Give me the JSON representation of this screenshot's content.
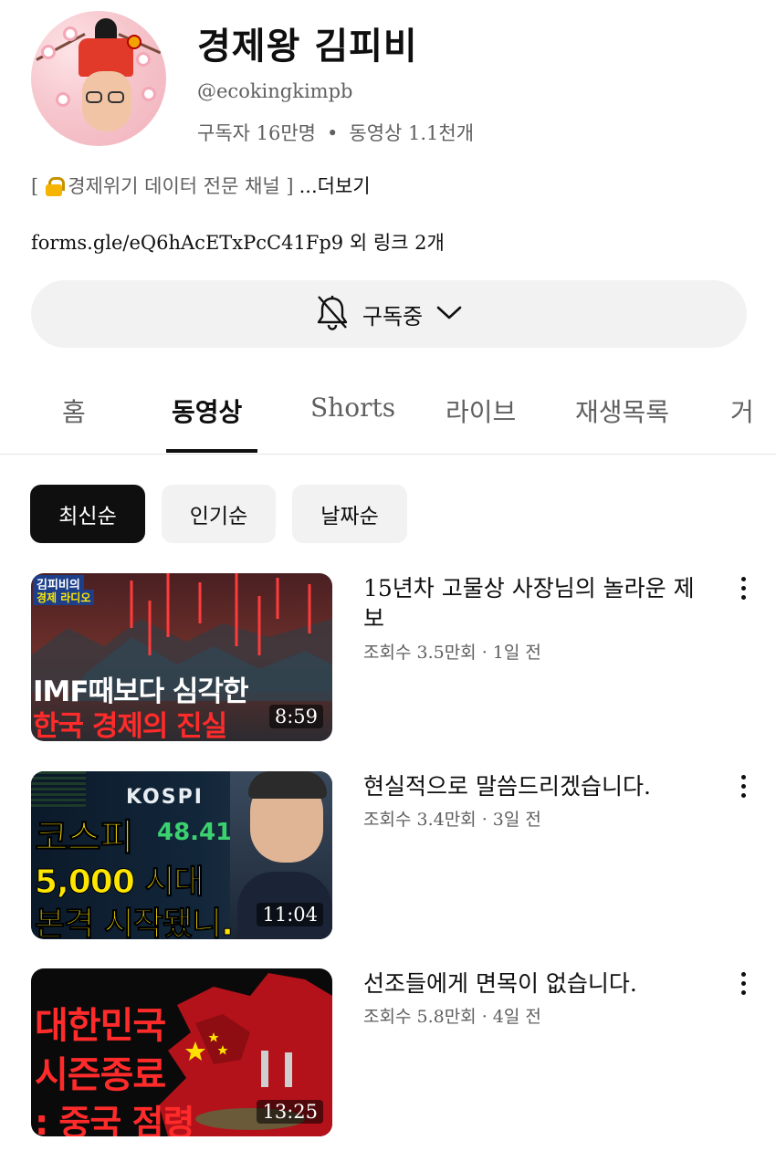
{
  "channel": {
    "name": "경제왕 김피비",
    "handle": "@ecokingkimpb",
    "subscribers": "구독자 16만명",
    "separator": "•",
    "video_count": "동영상 1.1천개",
    "description_open": "[",
    "description_text": "경제위기 데이터 전문 채널 ]",
    "description_more": "...더보기",
    "link_url": "forms.gle/eQ6hAcETxPcC41Fp9",
    "link_more": " 외 링크 2개"
  },
  "subscribe": {
    "label": "구독중"
  },
  "tabs": [
    {
      "label": "홈"
    },
    {
      "label": "동영상"
    },
    {
      "label": "Shorts"
    },
    {
      "label": "라이브"
    },
    {
      "label": "재생목록"
    },
    {
      "label": "거"
    }
  ],
  "active_tab": "동영상",
  "chips": [
    {
      "label": "최신순"
    },
    {
      "label": "인기순"
    },
    {
      "label": "날짜순"
    }
  ],
  "videos": [
    {
      "title": "15년차 고물상 사장님의 놀라운 제보",
      "meta": "조회수 3.5만회 · 1일 전",
      "duration": "8:59",
      "thumb_badge_1": "김피비의",
      "thumb_badge_2": "경제 라디오",
      "thumb_line_1": "IMF때보다 심각한",
      "thumb_line_2": "한국 경제의 진실"
    },
    {
      "title": "현실적으로 말씀드리겠습니다.",
      "meta": "조회수 3.4만회 · 3일 전",
      "duration": "11:04",
      "thumb_ticker": "KOSPI",
      "thumb_number": "48.41",
      "thumb_line_1": "코스피",
      "thumb_line_2": "5,000 시대",
      "thumb_line_3": "본격 시작됐니."
    },
    {
      "title": "선조들에게 면목이 없습니다.",
      "meta": "조회수 5.8만회 · 4일 전",
      "duration": "13:25",
      "thumb_line_1": "대한민국",
      "thumb_line_2": "시즌종료",
      "thumb_line_3": ": 중국 점령"
    }
  ],
  "colors": {
    "text_primary": "#0f0f0f",
    "text_secondary": "#606060",
    "chip_bg": "#f2f2f2",
    "chip_active_bg": "#0f0f0f",
    "thumb_red": "#ff2b2b",
    "thumb_yellow": "#ffe600"
  },
  "icons": [
    "bell-off-icon",
    "chevron-down-icon",
    "lock-icon",
    "more-vert-icon"
  ]
}
